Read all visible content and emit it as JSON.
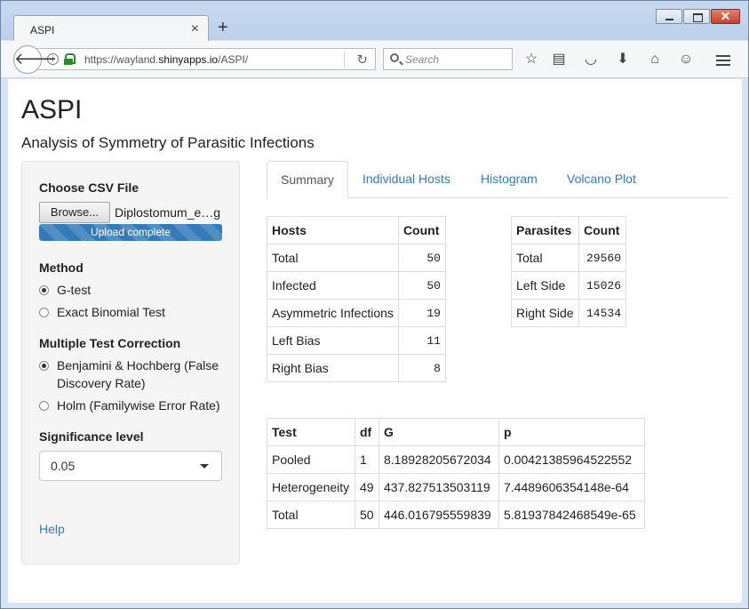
{
  "browser": {
    "tab_title": "ASPI",
    "url_prefix": "https://wayland.",
    "url_domain": "shinyapps.io",
    "url_suffix": "/ASPI/",
    "search_placeholder": "Search"
  },
  "app": {
    "title": "ASPI",
    "subtitle": "Analysis of Symmetry of Parasitic Infections"
  },
  "sidebar": {
    "file_label": "Choose CSV File",
    "browse_label": "Browse...",
    "file_name": "Diplostomum_e…g",
    "upload_status": "Upload complete",
    "method_label": "Method",
    "method_options": [
      "G-test",
      "Exact Binomial Test"
    ],
    "method_selected": "G-test",
    "correction_label": "Multiple Test Correction",
    "correction_options": [
      "Benjamini & Hochberg (False Discovery Rate)",
      "Holm (Familywise Error Rate)"
    ],
    "correction_selected": "Benjamini & Hochberg (False Discovery Rate)",
    "significance_label": "Significance level",
    "significance_value": "0.05",
    "help_label": "Help"
  },
  "tabs": [
    "Summary",
    "Individual Hosts",
    "Histogram",
    "Volcano Plot"
  ],
  "active_tab": "Summary",
  "hosts_table": {
    "headers": [
      "Hosts",
      "Count"
    ],
    "rows": [
      [
        "Total",
        "50"
      ],
      [
        "Infected",
        "50"
      ],
      [
        "Asymmetric Infections",
        "19"
      ],
      [
        "Left Bias",
        "11"
      ],
      [
        "Right Bias",
        "8"
      ]
    ]
  },
  "parasites_table": {
    "headers": [
      "Parasites",
      "Count"
    ],
    "rows": [
      [
        "Total",
        "29560"
      ],
      [
        "Left Side",
        "15026"
      ],
      [
        "Right Side",
        "14534"
      ]
    ]
  },
  "test_table": {
    "headers": [
      "Test",
      "df",
      "G",
      "p"
    ],
    "rows": [
      [
        "Pooled",
        "1",
        "8.18928205672034",
        "0.00421385964522552"
      ],
      [
        "Heterogeneity",
        "49",
        "437.827513503119",
        "7.4489606354148e-64"
      ],
      [
        "Total",
        "50",
        "446.016795559839",
        "5.81937842468549e-65"
      ]
    ]
  }
}
